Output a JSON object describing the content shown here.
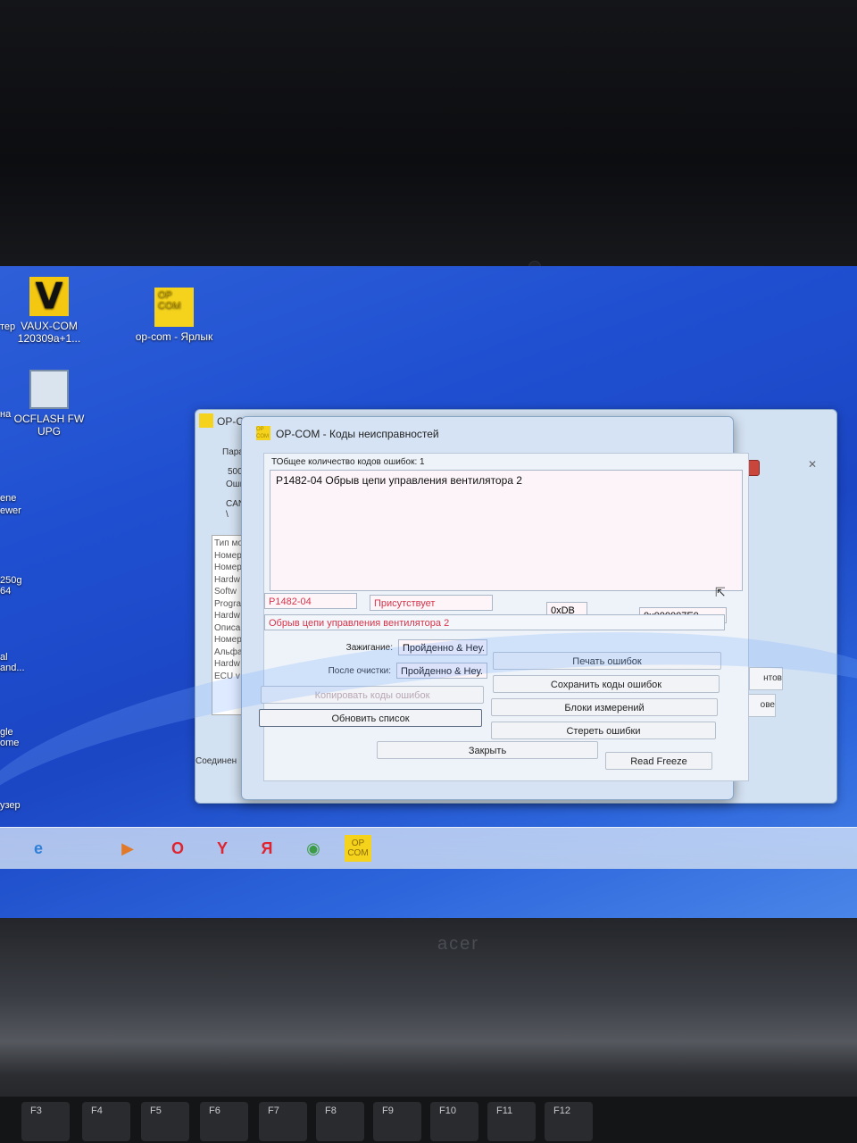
{
  "desktop": {
    "icons": [
      {
        "id": "vaux",
        "label": "VAUX-COM 120309a+1...",
        "glyph": "V"
      },
      {
        "id": "opcom",
        "label": "op-com - Ярлык",
        "glyph": "OP COM"
      },
      {
        "id": "ocflash",
        "label": "OCFLASH FW UPG"
      }
    ],
    "edge_labels": [
      "тер",
      "на",
      "ene",
      "ewer",
      "250g",
      "64",
      "al",
      "and...",
      "gle",
      "ome",
      "узер"
    ]
  },
  "back_window": {
    "title": "OP-COM",
    "close_glyph": "✕",
    "side_texts": [
      "Парам",
      "500 k",
      "Ошиб",
      "CAN I",
      "\\"
    ],
    "list_items": [
      "Тип мо",
      "Номер",
      "Номер",
      "Hardw",
      "Softw",
      "Progra",
      "Hardw",
      "Описа",
      "Номер",
      "Альфа",
      "Hardw",
      "ECU v"
    ],
    "right_buttons": [
      "нтов",
      "ове"
    ],
    "status": "Соединен"
  },
  "dialog": {
    "logo": "OP COM",
    "title": "OP-COM - Коды неисправностей",
    "close_glyph": "✕",
    "count_label": "ТОбщее количество кодов ошибок: 1",
    "codes": [
      "P1482-04 Обрыв цепи управления вентилятора 2"
    ],
    "detail": {
      "code": "P1482-04",
      "state": "Присутствует",
      "hex1": "0xDB",
      "hex2": "0x000007E0",
      "description": "Обрыв цепи управления вентилятора 2"
    },
    "ignition_label": "Зажигание:",
    "ignition_value": "Пройденно & Неу.",
    "after_clear_label": "После очистки:",
    "after_clear_value": "Пройденно & Неу.",
    "buttons": {
      "copy": "Копировать коды ошибок",
      "refresh": "Обновить список",
      "print": "Печать ошибок",
      "save": "Сохранить коды ошибок",
      "blocks": "Блоки измерений",
      "erase": "Стереть ошибки",
      "close": "Закрыть",
      "freeze": "Read Freeze"
    }
  },
  "taskbar": {
    "items": [
      {
        "id": "ie",
        "glyph": "e"
      },
      {
        "id": "media",
        "glyph": "▶"
      },
      {
        "id": "opera",
        "glyph": "O"
      },
      {
        "id": "yandex",
        "glyph": "Y"
      },
      {
        "id": "yabrowser",
        "glyph": "Я"
      },
      {
        "id": "chrome",
        "glyph": "◉"
      },
      {
        "id": "opcom",
        "glyph": "OP COM"
      }
    ]
  },
  "laptop": {
    "brand": "acer",
    "keys": [
      "F3",
      "F4",
      "F5",
      "F6",
      "F7",
      "F8",
      "F9",
      "F10",
      "F11",
      "F12"
    ]
  },
  "colors": {
    "desktop_blue": "#1f4fd0",
    "error_red": "#d6344a",
    "window_bg": "#d5e3f4",
    "opcom_yellow": "#f5d21b"
  }
}
